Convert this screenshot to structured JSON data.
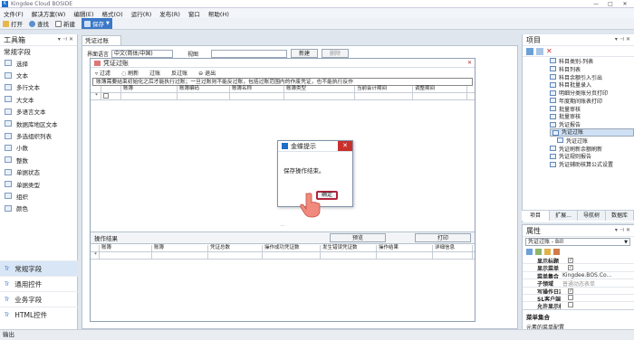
{
  "window": {
    "title": "Kingdee Cloud BOSIDE",
    "controls": [
      "—",
      "□",
      "✕"
    ]
  },
  "menu": [
    "文件(F)",
    "解决方案(W)",
    "编辑(E)",
    "格式(O)",
    "运行(R)",
    "发布(R)",
    "窗口",
    "帮助(H)"
  ],
  "toolbar": {
    "open": "打开",
    "find": "查找",
    "new": "新建",
    "save": "保存"
  },
  "left_panel": {
    "title": "工具箱",
    "section": "常规字段",
    "tools": [
      "选择",
      "文本",
      "多行文本",
      "大文本",
      "多语言文本",
      "数据库地区文本",
      "多选组织列表",
      "小数",
      "整数",
      "单据状态",
      "单据类型",
      "组织",
      "颜色"
    ],
    "categories": [
      {
        "label": "常规字段",
        "prefix": "Tr"
      },
      {
        "label": "通用控件",
        "prefix": "Tr"
      },
      {
        "label": "业务字段",
        "prefix": "Tr"
      },
      {
        "label": "HTML控件",
        "prefix": "Tr"
      }
    ]
  },
  "doc_tab": "凭证过账",
  "lang_row": {
    "label": "界面语言",
    "value": "中文(简体/中国)",
    "view_label": "视图",
    "new_btn": "新建",
    "delete_btn": "删除"
  },
  "designer": {
    "title": "凭证过账",
    "tools": [
      "过滤",
      "刷新",
      "过账",
      "反过账",
      "退出"
    ],
    "notice": "账簿需要结束初始化之后才能执行过账；一旦过账则不能反过账，包括过账范围内的作废凭证，也不能执行反作",
    "grid_columns": [
      "账簿",
      "账簿编码",
      "账簿名称",
      "账簿类型",
      "当前会计期间",
      "调整期间"
    ],
    "result_label": "操作结果",
    "result_buttons": [
      "预览",
      "打印"
    ],
    "result_columns": [
      "账簿",
      "账簿",
      "凭证总数",
      "操作成功凭证数",
      "发生错误凭证数",
      "操作结果",
      "详细信息"
    ]
  },
  "dialog": {
    "title": "金蝶提示",
    "message": "保存操作结束。",
    "ok": "确定",
    "close": "✕"
  },
  "project_panel": {
    "title": "项目",
    "items": [
      {
        "label": "科目类别-列表",
        "selected": false
      },
      {
        "label": "科目列表",
        "selected": false
      },
      {
        "label": "科目余额引入引出",
        "selected": false
      },
      {
        "label": "科目批量录入",
        "selected": false
      },
      {
        "label": "明细分类账分页打印",
        "selected": false
      },
      {
        "label": "年度期间账表打印",
        "selected": false
      },
      {
        "label": "批量审核",
        "selected": false
      },
      {
        "label": "批量审核",
        "selected": false
      },
      {
        "label": "凭证报告",
        "selected": false
      },
      {
        "label": "凭证过账",
        "selected": true
      },
      {
        "label": "凭证过账",
        "selected": false
      },
      {
        "label": "凭证刷新余额刷新",
        "selected": false
      },
      {
        "label": "凭证规则报告",
        "selected": false
      },
      {
        "label": "凭证辅助核算公式设置",
        "selected": false
      }
    ],
    "tabs": [
      "项目",
      "扩展...",
      "导航树",
      "数据库"
    ]
  },
  "properties": {
    "title": "属性",
    "object": "凭证过账 - Bill",
    "rows": [
      {
        "key": "显示标题",
        "value": "",
        "checked": true
      },
      {
        "key": "显示菜单",
        "value": "",
        "checked": true
      },
      {
        "key": "菜单集合",
        "value": "Kingdee.BOS.Co...",
        "checked": false
      },
      {
        "key": "子领域",
        "value": "普通动态表单",
        "checked": false
      },
      {
        "key": "写操作日志",
        "value": "",
        "checked": true
      },
      {
        "key": "SL客户端插件",
        "value": "",
        "checked": false
      },
      {
        "key": "允许显示标题",
        "value": "",
        "checked": false
      }
    ],
    "desc_title": "菜单集合",
    "desc_text": "元素的菜单配置"
  },
  "status": "输出"
}
